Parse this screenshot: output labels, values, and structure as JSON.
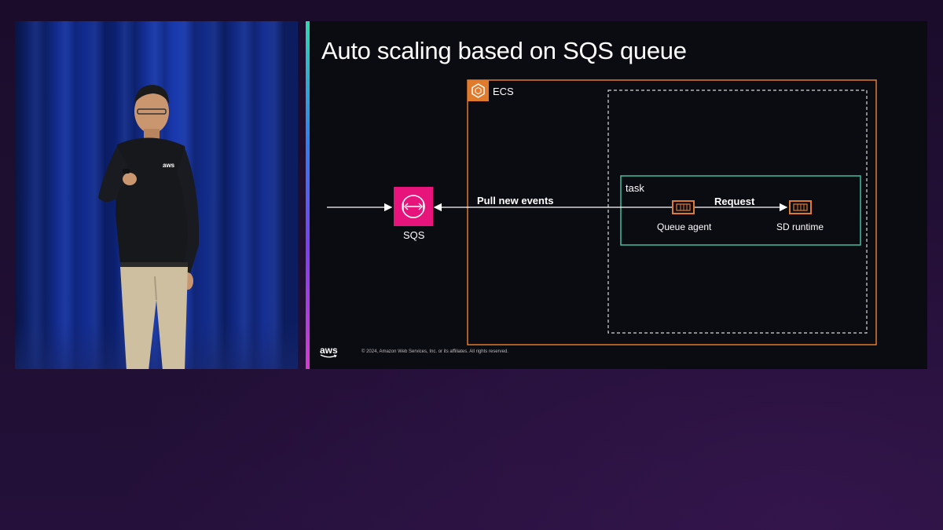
{
  "slide": {
    "title": "Auto scaling based on SQS queue",
    "copyright": "© 2024, Amazon Web Services, Inc. or its affiliates. All rights reserved.",
    "logo_text": "aws"
  },
  "diagram": {
    "ecs_label": "ECS",
    "task_label": "task",
    "sqs_label": "SQS",
    "pull_label": "Pull new events",
    "request_label": "Request",
    "queue_agent_label": "Queue agent",
    "sd_runtime_label": "SD runtime"
  },
  "video": {
    "shirt_logo": "aws"
  },
  "colors": {
    "ecs_orange": "#e07b2e",
    "sqs_pink": "#e7157b",
    "task_green": "#3fbf9f",
    "slide_bg": "#0b0b12",
    "page_bg": "#1e0e30"
  },
  "icons": [
    "ecs-icon",
    "sqs-icon",
    "queue-agent-icon",
    "sd-runtime-icon",
    "aws-logo"
  ]
}
